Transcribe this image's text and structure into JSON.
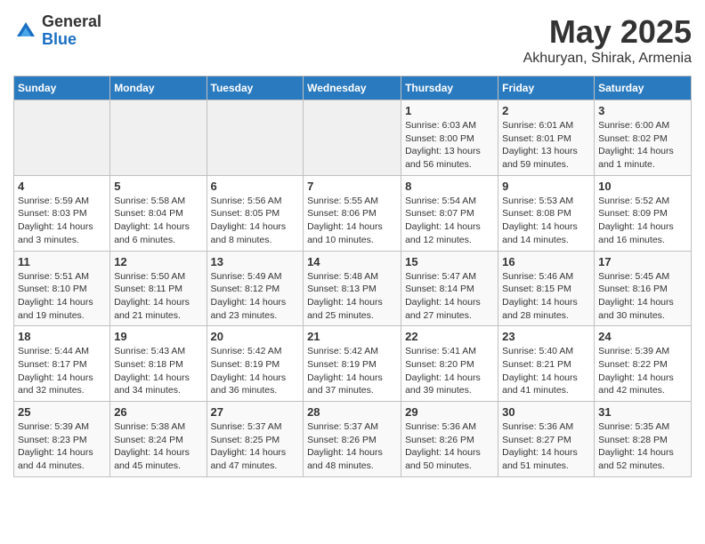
{
  "logo": {
    "general": "General",
    "blue": "Blue"
  },
  "header": {
    "month_year": "May 2025",
    "location": "Akhuryan, Shirak, Armenia"
  },
  "days_of_week": [
    "Sunday",
    "Monday",
    "Tuesday",
    "Wednesday",
    "Thursday",
    "Friday",
    "Saturday"
  ],
  "weeks": [
    [
      {
        "day": "",
        "info": ""
      },
      {
        "day": "",
        "info": ""
      },
      {
        "day": "",
        "info": ""
      },
      {
        "day": "",
        "info": ""
      },
      {
        "day": "1",
        "info": "Sunrise: 6:03 AM\nSunset: 8:00 PM\nDaylight: 13 hours and 56 minutes."
      },
      {
        "day": "2",
        "info": "Sunrise: 6:01 AM\nSunset: 8:01 PM\nDaylight: 13 hours and 59 minutes."
      },
      {
        "day": "3",
        "info": "Sunrise: 6:00 AM\nSunset: 8:02 PM\nDaylight: 14 hours and 1 minute."
      }
    ],
    [
      {
        "day": "4",
        "info": "Sunrise: 5:59 AM\nSunset: 8:03 PM\nDaylight: 14 hours and 3 minutes."
      },
      {
        "day": "5",
        "info": "Sunrise: 5:58 AM\nSunset: 8:04 PM\nDaylight: 14 hours and 6 minutes."
      },
      {
        "day": "6",
        "info": "Sunrise: 5:56 AM\nSunset: 8:05 PM\nDaylight: 14 hours and 8 minutes."
      },
      {
        "day": "7",
        "info": "Sunrise: 5:55 AM\nSunset: 8:06 PM\nDaylight: 14 hours and 10 minutes."
      },
      {
        "day": "8",
        "info": "Sunrise: 5:54 AM\nSunset: 8:07 PM\nDaylight: 14 hours and 12 minutes."
      },
      {
        "day": "9",
        "info": "Sunrise: 5:53 AM\nSunset: 8:08 PM\nDaylight: 14 hours and 14 minutes."
      },
      {
        "day": "10",
        "info": "Sunrise: 5:52 AM\nSunset: 8:09 PM\nDaylight: 14 hours and 16 minutes."
      }
    ],
    [
      {
        "day": "11",
        "info": "Sunrise: 5:51 AM\nSunset: 8:10 PM\nDaylight: 14 hours and 19 minutes."
      },
      {
        "day": "12",
        "info": "Sunrise: 5:50 AM\nSunset: 8:11 PM\nDaylight: 14 hours and 21 minutes."
      },
      {
        "day": "13",
        "info": "Sunrise: 5:49 AM\nSunset: 8:12 PM\nDaylight: 14 hours and 23 minutes."
      },
      {
        "day": "14",
        "info": "Sunrise: 5:48 AM\nSunset: 8:13 PM\nDaylight: 14 hours and 25 minutes."
      },
      {
        "day": "15",
        "info": "Sunrise: 5:47 AM\nSunset: 8:14 PM\nDaylight: 14 hours and 27 minutes."
      },
      {
        "day": "16",
        "info": "Sunrise: 5:46 AM\nSunset: 8:15 PM\nDaylight: 14 hours and 28 minutes."
      },
      {
        "day": "17",
        "info": "Sunrise: 5:45 AM\nSunset: 8:16 PM\nDaylight: 14 hours and 30 minutes."
      }
    ],
    [
      {
        "day": "18",
        "info": "Sunrise: 5:44 AM\nSunset: 8:17 PM\nDaylight: 14 hours and 32 minutes."
      },
      {
        "day": "19",
        "info": "Sunrise: 5:43 AM\nSunset: 8:18 PM\nDaylight: 14 hours and 34 minutes."
      },
      {
        "day": "20",
        "info": "Sunrise: 5:42 AM\nSunset: 8:19 PM\nDaylight: 14 hours and 36 minutes."
      },
      {
        "day": "21",
        "info": "Sunrise: 5:42 AM\nSunset: 8:19 PM\nDaylight: 14 hours and 37 minutes."
      },
      {
        "day": "22",
        "info": "Sunrise: 5:41 AM\nSunset: 8:20 PM\nDaylight: 14 hours and 39 minutes."
      },
      {
        "day": "23",
        "info": "Sunrise: 5:40 AM\nSunset: 8:21 PM\nDaylight: 14 hours and 41 minutes."
      },
      {
        "day": "24",
        "info": "Sunrise: 5:39 AM\nSunset: 8:22 PM\nDaylight: 14 hours and 42 minutes."
      }
    ],
    [
      {
        "day": "25",
        "info": "Sunrise: 5:39 AM\nSunset: 8:23 PM\nDaylight: 14 hours and 44 minutes."
      },
      {
        "day": "26",
        "info": "Sunrise: 5:38 AM\nSunset: 8:24 PM\nDaylight: 14 hours and 45 minutes."
      },
      {
        "day": "27",
        "info": "Sunrise: 5:37 AM\nSunset: 8:25 PM\nDaylight: 14 hours and 47 minutes."
      },
      {
        "day": "28",
        "info": "Sunrise: 5:37 AM\nSunset: 8:26 PM\nDaylight: 14 hours and 48 minutes."
      },
      {
        "day": "29",
        "info": "Sunrise: 5:36 AM\nSunset: 8:26 PM\nDaylight: 14 hours and 50 minutes."
      },
      {
        "day": "30",
        "info": "Sunrise: 5:36 AM\nSunset: 8:27 PM\nDaylight: 14 hours and 51 minutes."
      },
      {
        "day": "31",
        "info": "Sunrise: 5:35 AM\nSunset: 8:28 PM\nDaylight: 14 hours and 52 minutes."
      }
    ]
  ]
}
